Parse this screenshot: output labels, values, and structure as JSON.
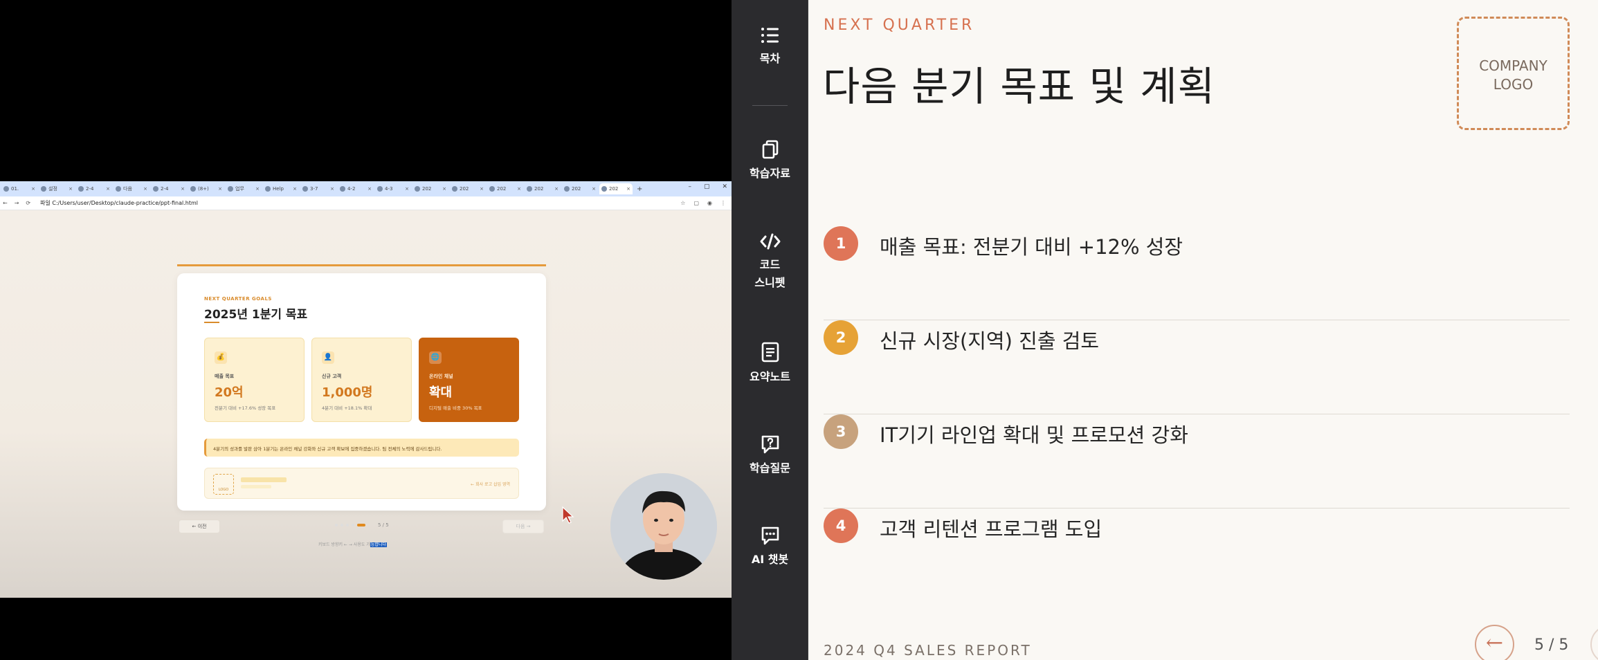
{
  "video": {
    "browser": {
      "tabs": [
        "01.",
        "설정",
        "2-4",
        "다음",
        "2-4",
        "(8+)",
        "업무",
        "Help",
        "3-7",
        "4-2",
        "4-3",
        "202",
        "202",
        "202",
        "202",
        "202",
        "202"
      ],
      "tab_plus": "+",
      "win_controls": [
        "–",
        "▢",
        "✕"
      ],
      "nav": [
        "←",
        "→",
        "⟳"
      ],
      "url_prefix": "파일",
      "url": "C:/Users/user/Desktop/claude-practice/ppt-final.html"
    },
    "card": {
      "eyebrow": "NEXT QUARTER GOALS",
      "title": "2025년 1분기 목표",
      "goals": [
        {
          "icon": "💰",
          "label": "매출 목표",
          "value": "20억",
          "sub": "전분기 대비 +17.6% 성장 목표"
        },
        {
          "icon": "👤",
          "label": "신규 고객",
          "value": "1,000명",
          "sub": "4분기 대비 +18.1% 확대"
        },
        {
          "icon": "🌐",
          "label": "온라인 채널",
          "value": "확대",
          "sub": "디지털 매출 비중 30% 목표"
        }
      ],
      "note": "4분기의 성과를 발판 삼아 1분기는 온라인 채널 강화와 신규 고객 확보에 집중하겠습니다. 팀 전체의 노력에 감사드립니다.",
      "logo_text": "LOGO",
      "logo_hint": "← 회사 로고 삽입 영역"
    },
    "prev_label": "← 이전",
    "next_label": "다음 →",
    "page": "5 / 5",
    "kbd_hint_prefix": "키보드 방향키 ← → 사용도 가",
    "kbd_hint_highlight": "능합니다"
  },
  "sidebar": {
    "items": [
      {
        "icon": "list-icon",
        "label": "목차"
      },
      {
        "icon": "copy-icon",
        "label": "학습자료"
      },
      {
        "icon": "code-icon",
        "label": "코드\n스니펫"
      },
      {
        "icon": "note-icon",
        "label": "요약노트"
      },
      {
        "icon": "question-icon",
        "label": "학습질문"
      },
      {
        "icon": "chat-icon",
        "label": "AI 챗봇"
      }
    ]
  },
  "slide": {
    "eyebrow": "NEXT QUARTER",
    "title": "다음 분기 목표 및 계획",
    "logo_placeholder": "COMPANY\nLOGO",
    "items": [
      {
        "number": "1",
        "text": "매출 목표: 전분기 대비 +12% 성장",
        "color": "#df7558"
      },
      {
        "number": "2",
        "text": "신규 시장(지역) 진출 검토",
        "color": "#e6a236"
      },
      {
        "number": "3",
        "text": "IT기기 라인업 확대 및 프로모션 강화",
        "color": "#c7a27d"
      },
      {
        "number": "4",
        "text": "고객 리텐션 프로그램 도입",
        "color": "#df7558"
      }
    ],
    "footer": "2024 Q4 SALES REPORT",
    "page_counter": "5 / 5",
    "prev_arrow": "←"
  }
}
